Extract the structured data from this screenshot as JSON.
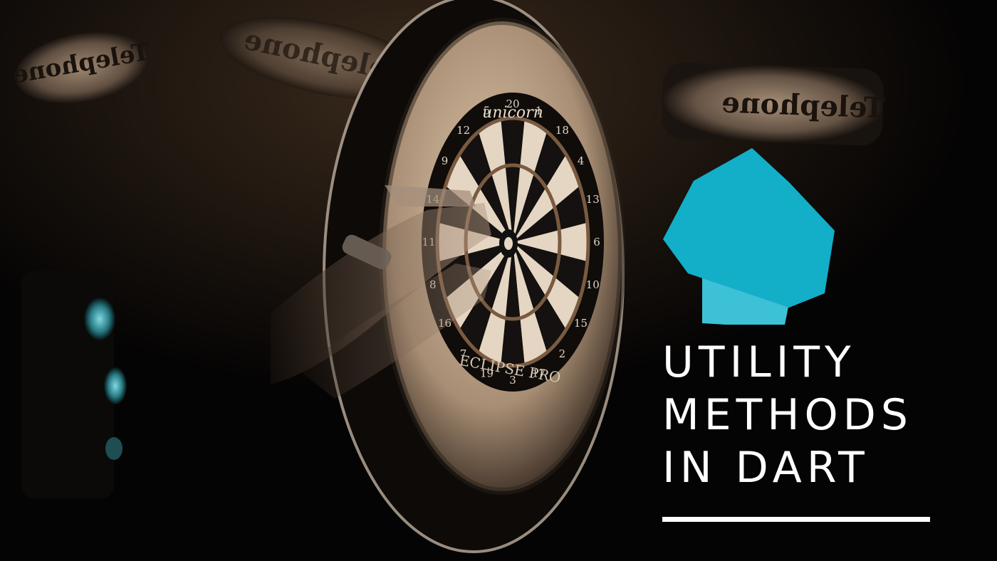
{
  "background": {
    "signs": [
      "Telephone",
      "Telephone",
      "Telephone"
    ],
    "dartboard": {
      "brand": "unicorn",
      "model": "ECLIPSE PRO",
      "numbers": [
        "20",
        "1",
        "18",
        "4",
        "13",
        "6",
        "10",
        "15",
        "2",
        "17",
        "3",
        "19",
        "7",
        "16",
        "8",
        "11",
        "14",
        "9",
        "12",
        "5"
      ]
    }
  },
  "logo": {
    "icon": "dart-logo-icon",
    "colors": {
      "primary": "#13aec8",
      "secondary": "#3dc1d6"
    }
  },
  "title": {
    "line1": "UTILITY",
    "line2": "METHODS",
    "line3": "IN DART"
  },
  "colors": {
    "text": "#ffffff",
    "background": "#050404",
    "board_beige": "#d8c2a8"
  }
}
